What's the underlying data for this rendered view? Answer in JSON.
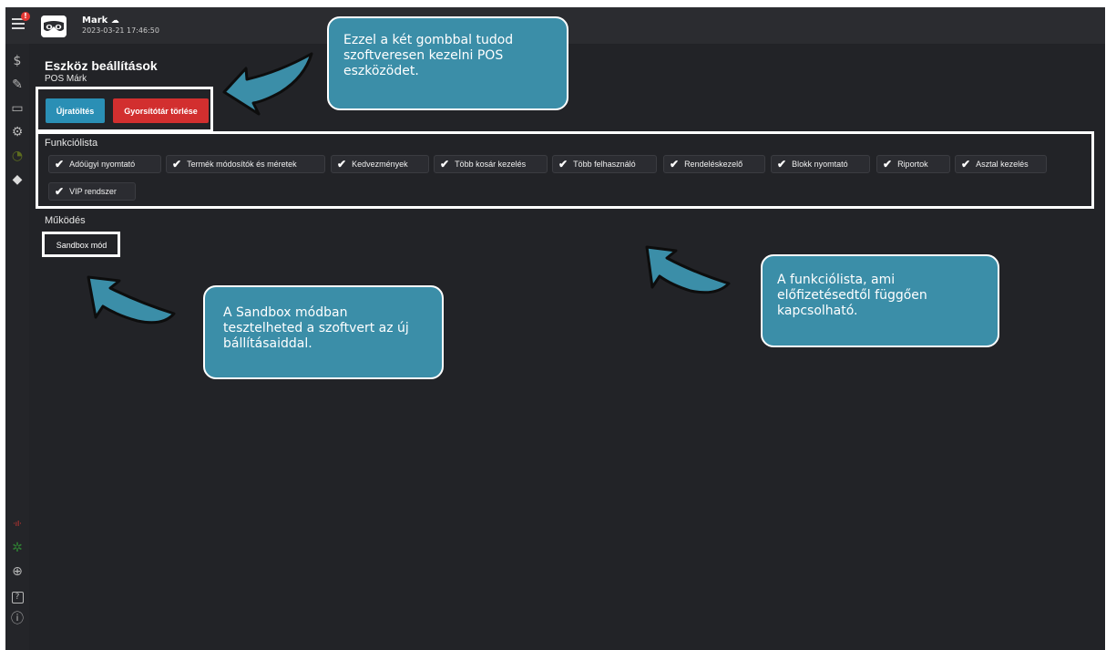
{
  "topbar": {
    "notification_count": "!",
    "user_name": "Mark",
    "cloud_icon": "cloud-icon",
    "datetime": "2023-03-21  17:46:50"
  },
  "sidebar": {
    "items": [
      {
        "icon": "dollar-icon",
        "glyph": "$"
      },
      {
        "icon": "edit-icon",
        "glyph": "✎"
      },
      {
        "icon": "receipt-icon",
        "glyph": "▭"
      },
      {
        "icon": "gear-icon",
        "glyph": "⚙"
      },
      {
        "icon": "timer-icon",
        "glyph": "◔"
      },
      {
        "icon": "tag-icon",
        "glyph": "◆"
      }
    ],
    "bottom_items": [
      {
        "icon": "signal-icon",
        "glyph": "·ıl·"
      },
      {
        "icon": "network-icon",
        "glyph": "✲"
      },
      {
        "icon": "globe-icon",
        "glyph": "⊕"
      },
      {
        "icon": "help-icon",
        "glyph": "?"
      },
      {
        "icon": "info-icon",
        "glyph": "ⓘ"
      }
    ]
  },
  "page": {
    "title": "Eszköz beállítások",
    "subtitle": "POS Márk"
  },
  "buttons": {
    "reload": "Újratöltés",
    "clear_cache": "Gyorsítótár törlése"
  },
  "features": {
    "label": "Funkciólista",
    "items": [
      "Adóügyi nyomtató",
      "Termék módosítók és méretek",
      "Kedvezmények",
      "Több kosár kezelés",
      "Több felhasználó",
      "Rendeléskezelő",
      "Blokk nyomtató",
      "Riportok",
      "Asztal kezelés",
      "VIP rendszer"
    ]
  },
  "operation": {
    "label": "Működés",
    "sandbox": "Sandbox mód"
  },
  "callouts": {
    "buttons": "Ezzel a két gombbal tudod szoftveresen kezelni POS eszközödet.",
    "features": "A funkciólista, ami előfizetésedtől függően kapcsolható.",
    "sandbox": "A Sandbox módban tesztelheted a szoftvert az új bállításaiddal."
  },
  "colors": {
    "background": "#222327",
    "reload_button": "#2a8fb5",
    "cache_button": "#d22f2f",
    "callout": "#3b8ea8",
    "highlight": "#ffffff"
  }
}
